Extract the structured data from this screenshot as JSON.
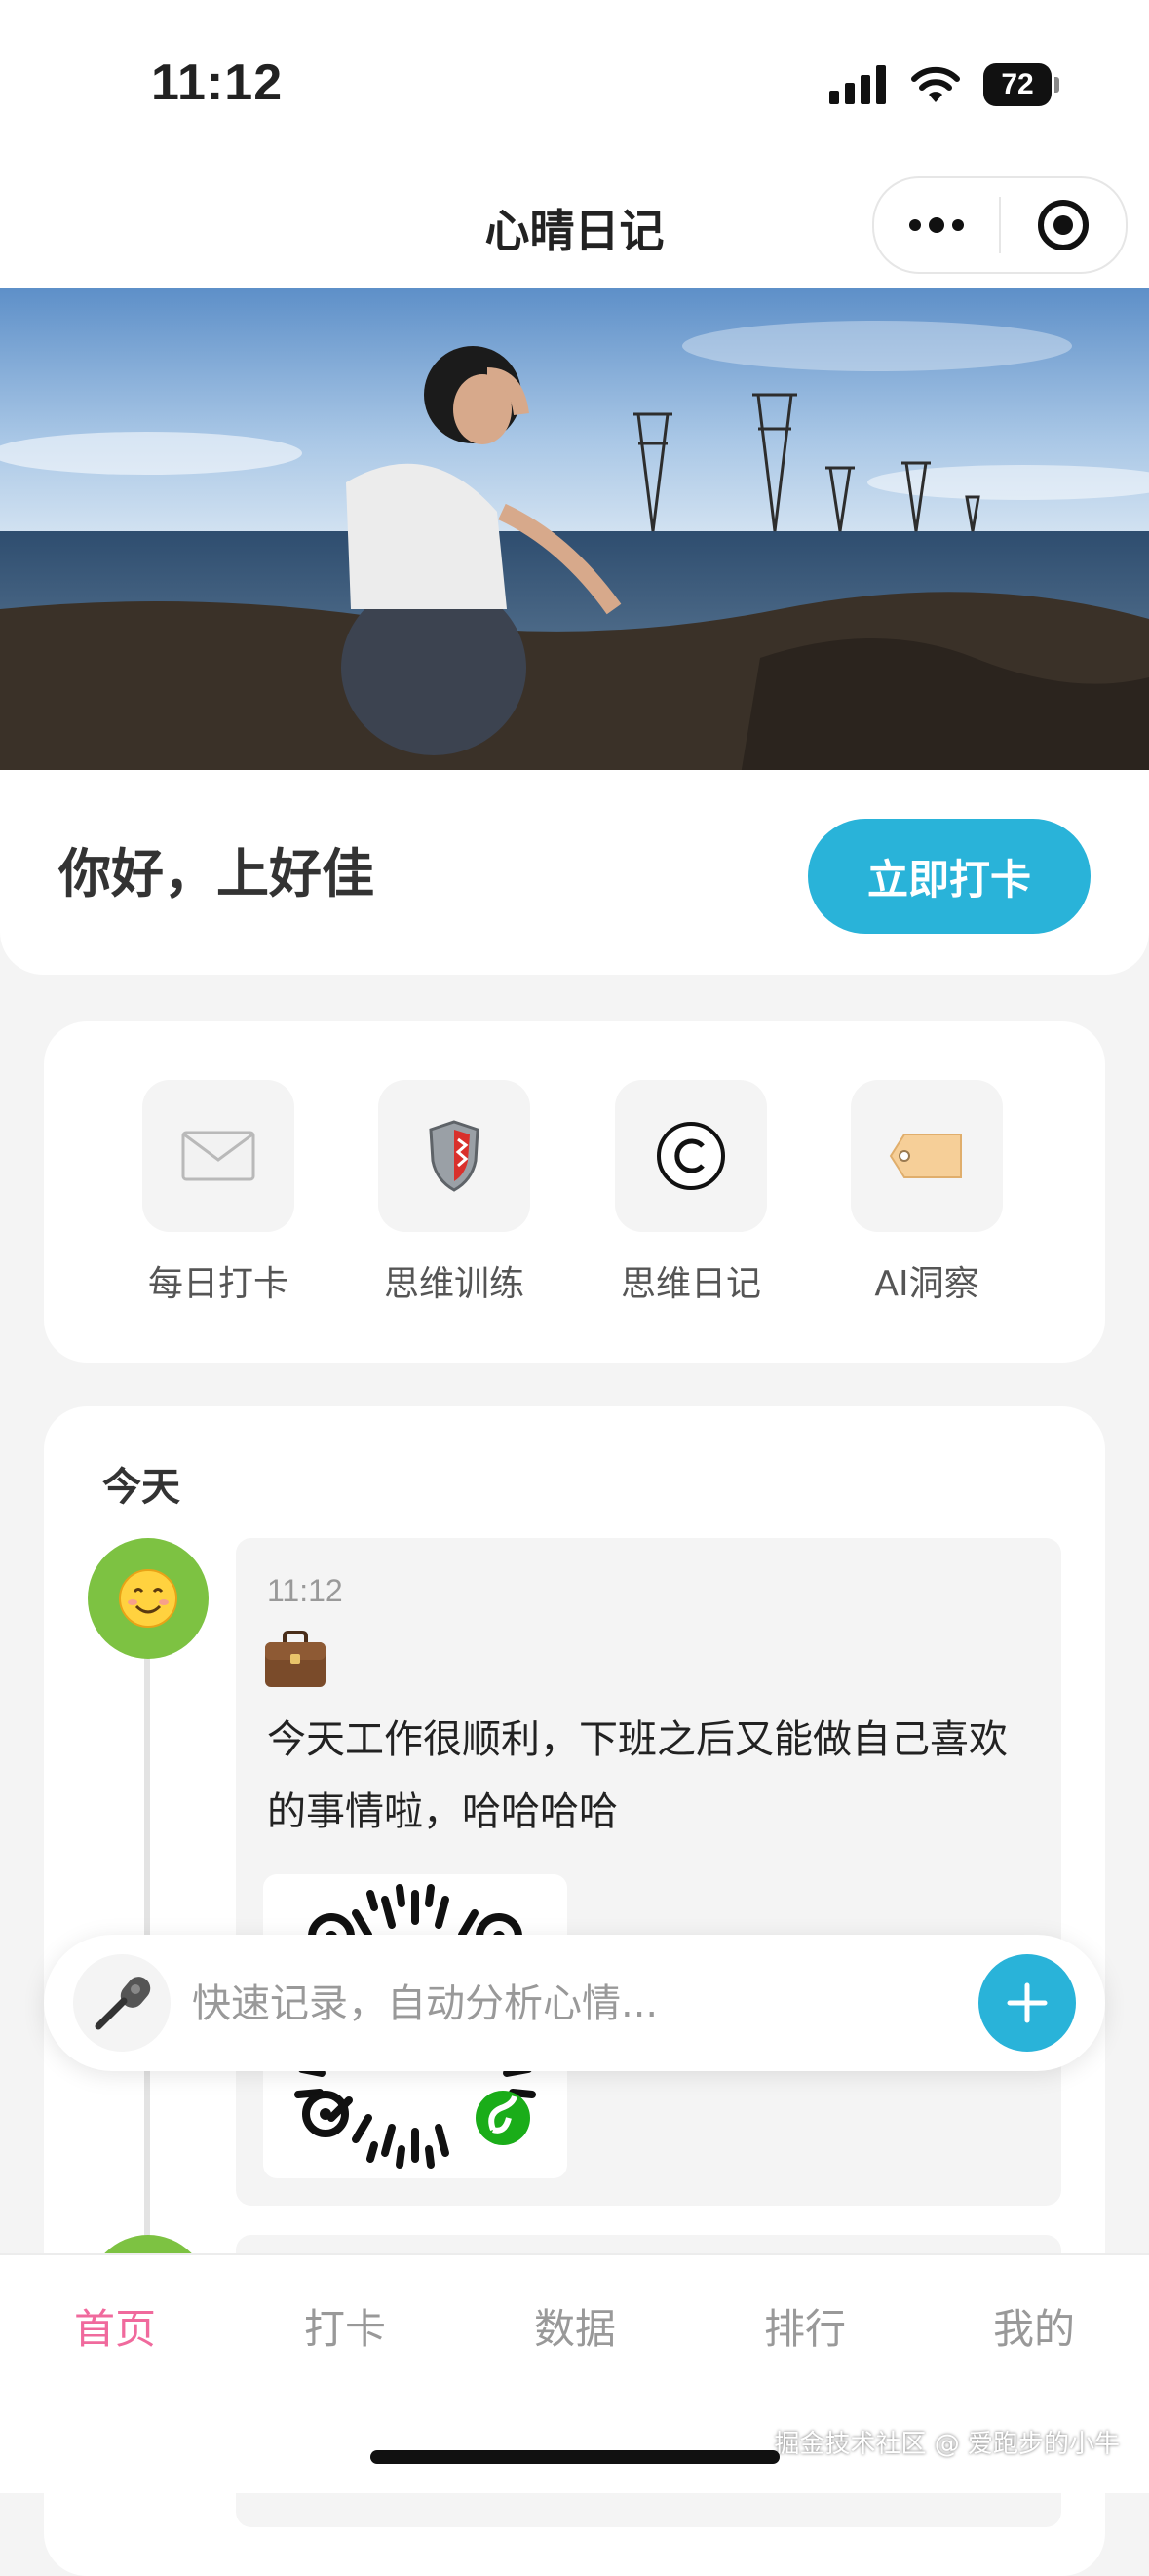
{
  "status_bar": {
    "time": "11:12",
    "battery": "72"
  },
  "nav": {
    "title": "心晴日记",
    "more_icon": "more-dots-icon",
    "close_icon": "record-target-icon"
  },
  "header": {
    "greeting": "你好，上好佳",
    "checkin_button": "立即打卡"
  },
  "shortcuts": [
    {
      "label": "每日打卡",
      "icon": "envelope-icon"
    },
    {
      "label": "思维训练",
      "icon": "shield-icon"
    },
    {
      "label": "思维日记",
      "icon": "copyright-icon"
    },
    {
      "label": "AI洞察",
      "icon": "tag-icon"
    }
  ],
  "timeline": {
    "section_title": "今天",
    "entries": [
      {
        "time": "11:12",
        "mood_icon": "smiling-face-icon",
        "category_icon": "briefcase-icon",
        "text": "今天工作很顺利，下班之后又能做自己喜欢的事情啦，哈哈哈哈"
      }
    ]
  },
  "quick_record": {
    "placeholder": "快速记录，自动分析心情..."
  },
  "tabs": [
    {
      "label": "首页",
      "active": true
    },
    {
      "label": "打卡"
    },
    {
      "label": "数据"
    },
    {
      "label": "排行"
    },
    {
      "label": "我的"
    }
  ],
  "watermark": "掘金技术社区 @ 爱跑步的小牛",
  "colors": {
    "accent": "#29b3d9",
    "tab_active": "#f06a9d",
    "avatar_green": "#7dc242"
  }
}
